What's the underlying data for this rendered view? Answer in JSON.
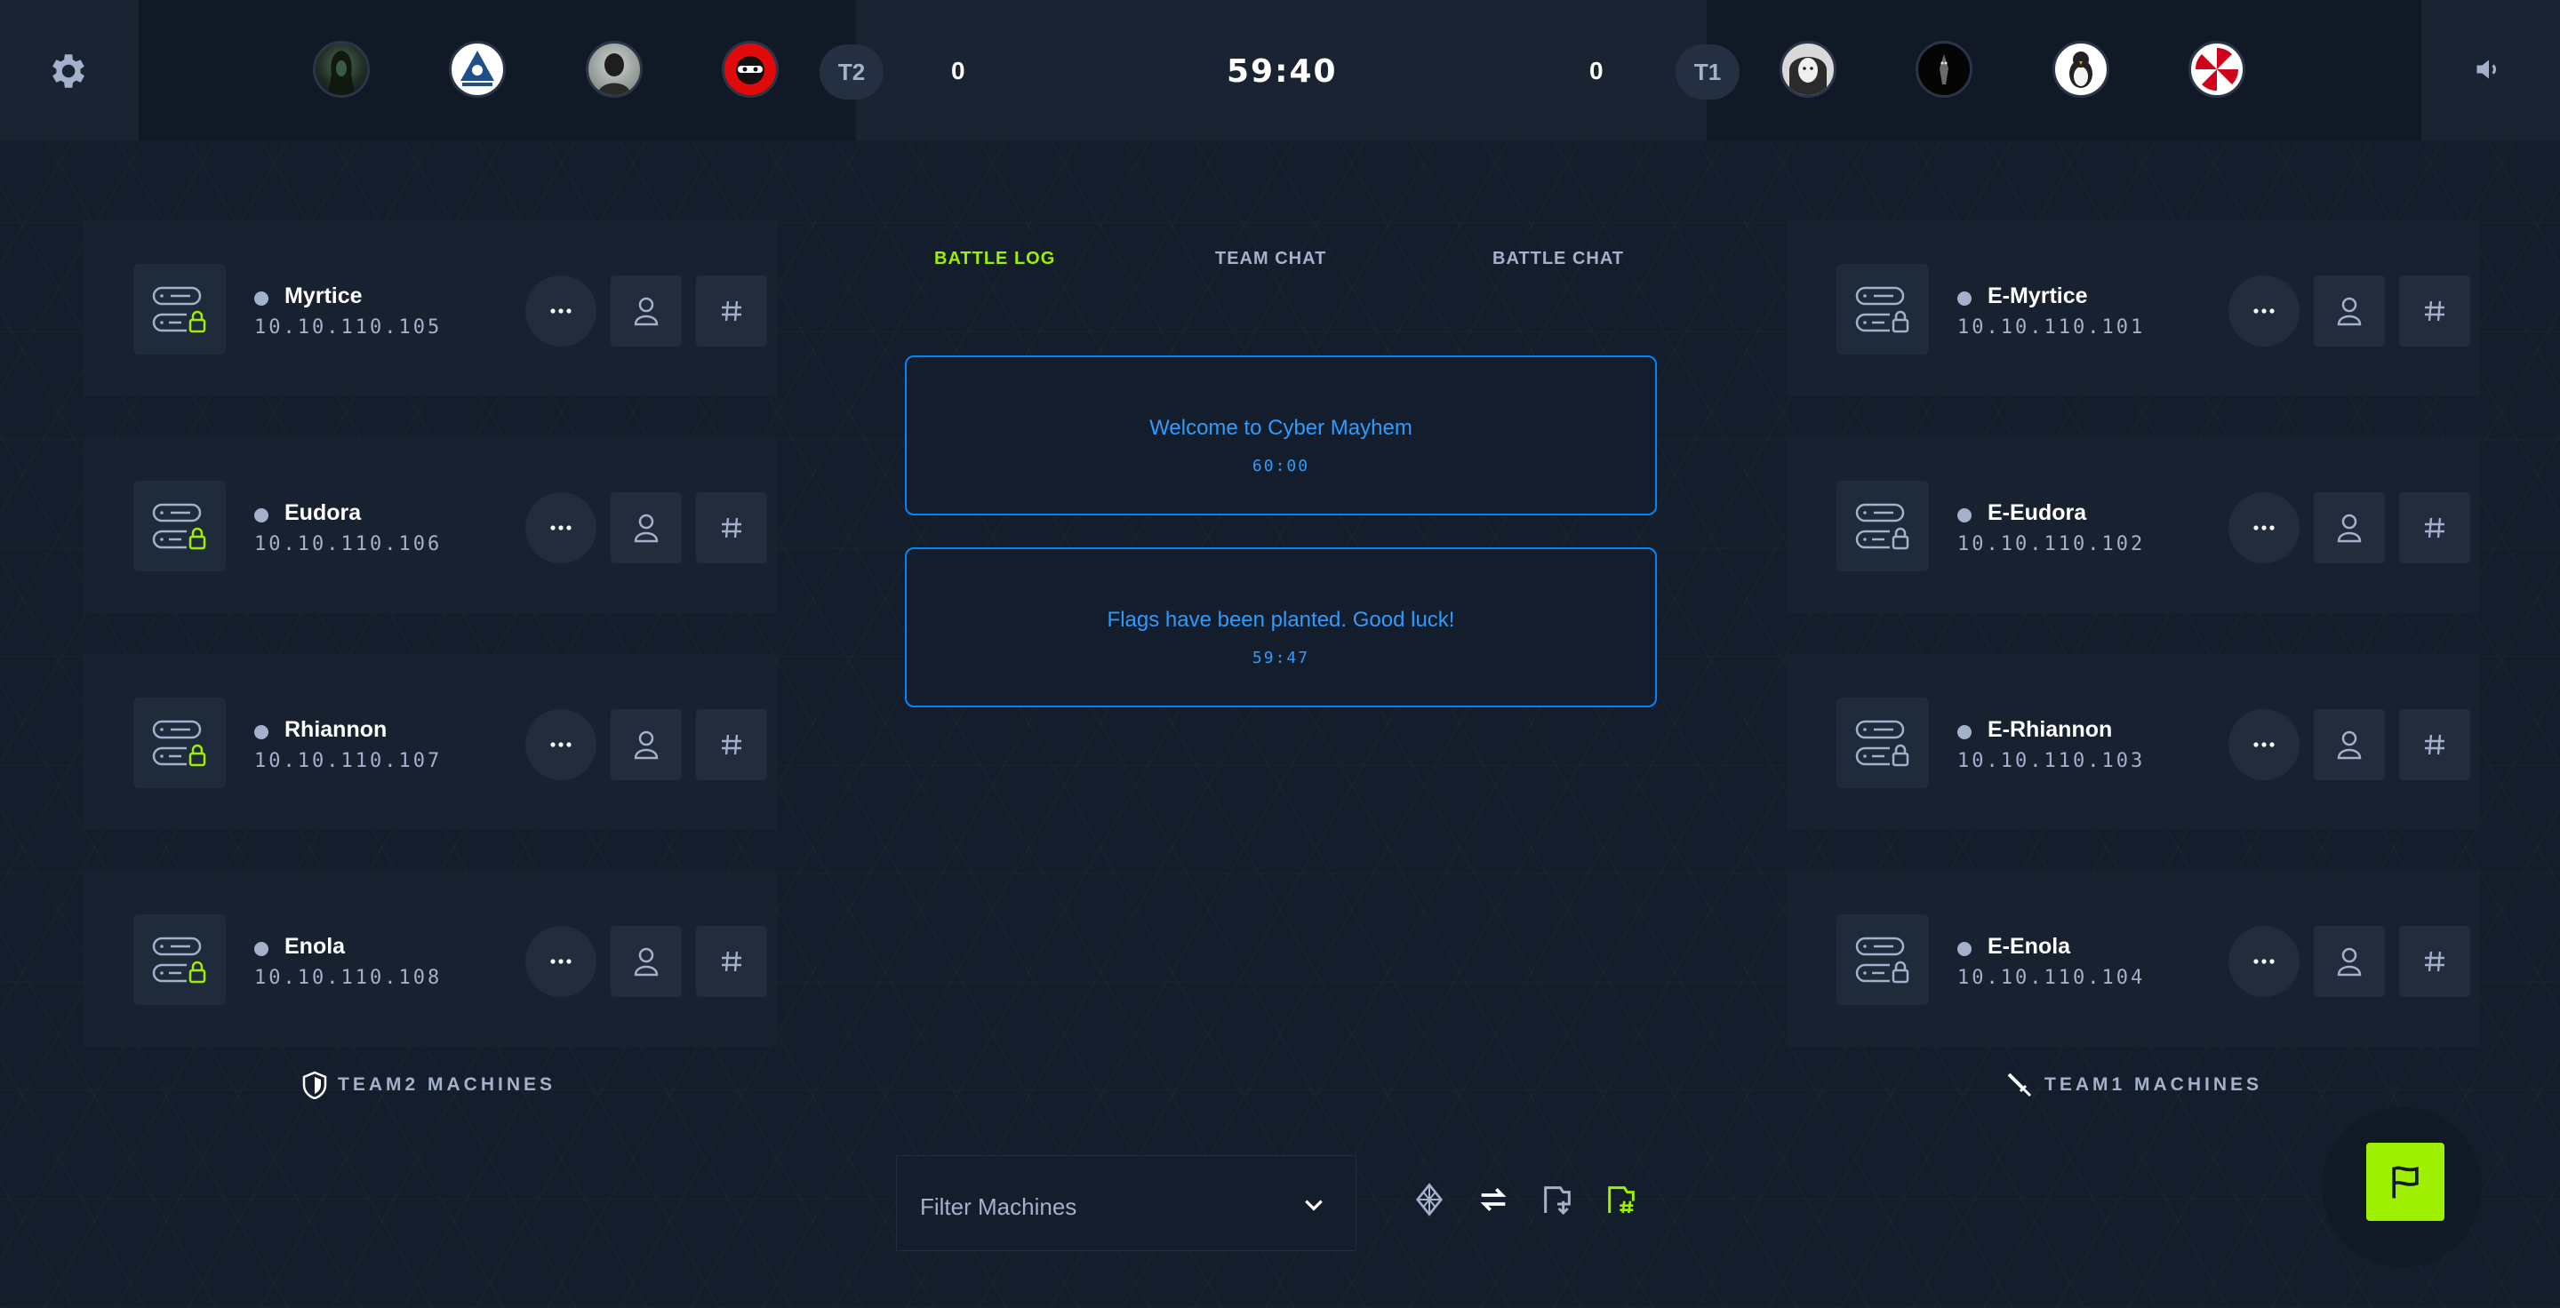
{
  "header": {
    "team2_label": "T2",
    "team1_label": "T1",
    "team2_score": "0",
    "team1_score": "0",
    "timer": "59:40",
    "team2_avatars": [
      "avatar-hooded-figure",
      "avatar-anonymous-mask",
      "avatar-masked-agent",
      "avatar-red-ninja"
    ],
    "team1_avatars": [
      "avatar-girl-sketch",
      "avatar-dark-figure",
      "avatar-penguin",
      "avatar-umbrella-logo"
    ]
  },
  "tabs": {
    "battle_log": "BATTLE LOG",
    "team_chat": "TEAM CHAT",
    "battle_chat": "BATTLE CHAT"
  },
  "battle_log": [
    {
      "message": "Welcome to Cyber Mayhem",
      "time": "60:00"
    },
    {
      "message": "Flags have been planted. Good luck!",
      "time": "59:47"
    }
  ],
  "team2_machines": [
    {
      "name": "Myrtice",
      "ip": "10.10.110.105"
    },
    {
      "name": "Eudora",
      "ip": "10.10.110.106"
    },
    {
      "name": "Rhiannon",
      "ip": "10.10.110.107"
    },
    {
      "name": "Enola",
      "ip": "10.10.110.108"
    }
  ],
  "team1_machines": [
    {
      "name": "E-Myrtice",
      "ip": "10.10.110.101"
    },
    {
      "name": "E-Eudora",
      "ip": "10.10.110.102"
    },
    {
      "name": "E-Rhiannon",
      "ip": "10.10.110.103"
    },
    {
      "name": "E-Enola",
      "ip": "10.10.110.104"
    }
  ],
  "sections": {
    "team2": "TEAM2 MACHINES",
    "team1": "TEAM1 MACHINES"
  },
  "filter": {
    "placeholder": "Filter Machines"
  },
  "colors": {
    "accent": "#9fef00",
    "log_blue": "#0086ff",
    "background": "#141d2b",
    "card": "#182130"
  }
}
